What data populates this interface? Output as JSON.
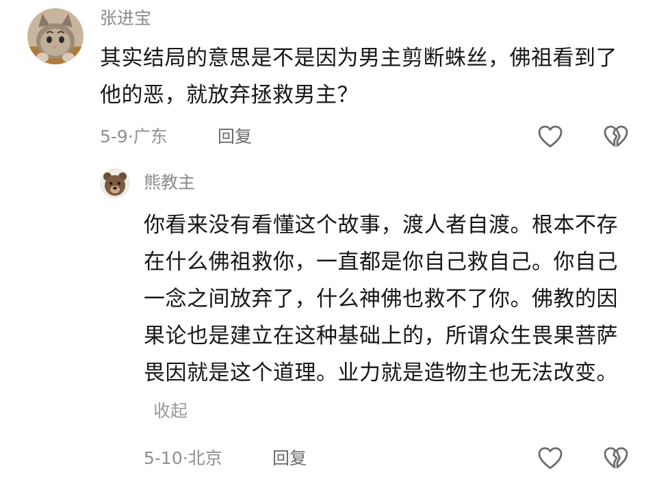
{
  "comments": [
    {
      "username": "张进宝",
      "avatar_icon": "cat-avatar-icon",
      "text": "其实结局的意思是不是因为男主剪断蛛丝，佛祖看到了他的恶，就放弃拯救男主？",
      "date": "5-9",
      "location": "广东",
      "reply_label": "回复",
      "like_icon": "heart-outline-icon",
      "dislike_icon": "broken-heart-icon"
    },
    {
      "username": "熊教主",
      "avatar_icon": "bear-avatar-icon",
      "text": "你看来没有看懂这个故事，渡人者自渡。根本不存在什么佛祖救你，一直都是你自己救自己。你自己一念之间放弃了，什么神佛也救不了你。佛教的因果论也是建立在这种基础上的，所谓众生畏果菩萨畏因就是这个道理。业力就是造物主也无法改变。",
      "collapse_label": "收起",
      "date": "5-10",
      "location": "北京",
      "reply_label": "回复",
      "like_icon": "heart-outline-icon",
      "dislike_icon": "broken-heart-icon"
    }
  ],
  "separator": "·",
  "colors": {
    "username": "#8a8a8a",
    "meta": "#8f8f8f",
    "collapse": "#9a9a9a",
    "text": "#161616"
  }
}
